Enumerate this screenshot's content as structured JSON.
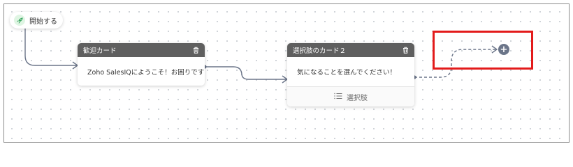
{
  "start_node": {
    "label": "開始する"
  },
  "cards": [
    {
      "title": "歓迎カード",
      "message": "Zoho SalesIQにようこそ！お困りですか？"
    },
    {
      "title": "選択肢のカード２",
      "message": "気になることを選んでください！",
      "footer_label": "選択肢"
    }
  ],
  "colors": {
    "header": "#5f5f5f",
    "connector": "#6b7589",
    "highlight": "#e31b1b",
    "start_icon": "#3fa864"
  },
  "icons": {
    "start": "rocket-icon",
    "delete": "trash-icon",
    "options": "list-icon",
    "add": "plus-icon"
  }
}
